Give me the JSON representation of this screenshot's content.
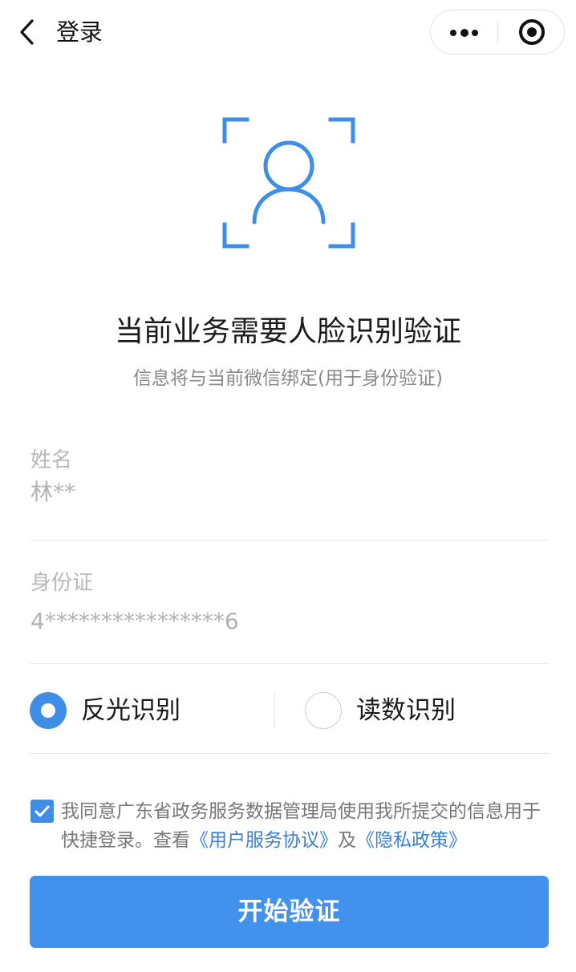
{
  "nav": {
    "title": "登录",
    "back_icon": "chevron-left-icon",
    "more_icon": "more-dots-icon",
    "close_icon": "target-circle-icon"
  },
  "hero": {
    "icon": "face-scan-icon",
    "headline": "当前业务需要人脸识别验证",
    "subtitle": "信息将与当前微信绑定(用于身份验证)"
  },
  "form": {
    "name_label": "姓名",
    "name_value": "林**",
    "id_label": "身份证",
    "id_value": "4****************6"
  },
  "mode": {
    "options": [
      {
        "label": "反光识别",
        "selected": true
      },
      {
        "label": "读数识别",
        "selected": false
      }
    ]
  },
  "agreement": {
    "checked": true,
    "text_prefix": "我同意广东省政务服务数据管理局使用我所提交的信息用于快捷登录。查看",
    "user_agreement_link": "《用户服务协议》",
    "conjunction": "及",
    "privacy_link": "《隐私政策》"
  },
  "actions": {
    "start_label": "开始验证"
  },
  "colors": {
    "accent": "#4291ed",
    "link": "#3a7fd0",
    "muted_text": "#b3b3b3"
  }
}
